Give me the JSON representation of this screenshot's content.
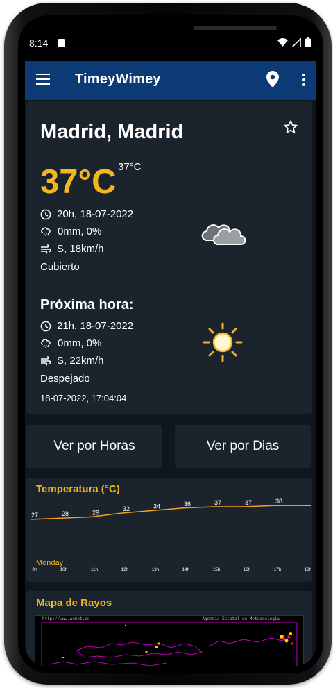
{
  "status_bar": {
    "time": "8:14"
  },
  "app_bar": {
    "title": "TimeyWimey"
  },
  "current": {
    "city": "Madrid, Madrid",
    "temperature": "37°C",
    "feels_like": "37°C",
    "datetime": "20h, 18-07-2022",
    "precipitation": "0mm, 0%",
    "wind": "S, 18km/h",
    "condition": "Cubierto",
    "condition_icon": "cloud-icon"
  },
  "next_hour": {
    "title": "Próxima hora:",
    "datetime": "21h, 18-07-2022",
    "precipitation": "0mm, 0%",
    "wind": "S, 22km/h",
    "condition": "Despejado",
    "condition_icon": "sun-icon"
  },
  "updated_at": "18-07-2022, 17:04:04",
  "buttons": {
    "hours": "Ver por Horas",
    "days": "Ver por Dias"
  },
  "chart_data": {
    "type": "line",
    "title": "Temperatura (°C)",
    "day_label": "Monday",
    "categories": [
      "9h",
      "10h",
      "11h",
      "12h",
      "13h",
      "14h",
      "15h",
      "16h",
      "17h",
      "18h"
    ],
    "series": [
      {
        "values": [
          27,
          28,
          29,
          32,
          34,
          36,
          37,
          37,
          38,
          38
        ]
      }
    ],
    "point_labels": [
      "27",
      "28",
      "29",
      "32",
      "34",
      "36",
      "37",
      "37",
      "38"
    ],
    "line_color": "#f0a020",
    "label_color": "#ffffff",
    "grid": false
  },
  "radar": {
    "title": "Mapa de Rayos",
    "url_text": "http://www.aemet.es",
    "agency_text": "Agencia Estatal de Meteorologia"
  },
  "colors": {
    "appbar": "#0b3a75",
    "accent": "#f3b61f",
    "background": "#10161d",
    "card": "#1b232d"
  }
}
